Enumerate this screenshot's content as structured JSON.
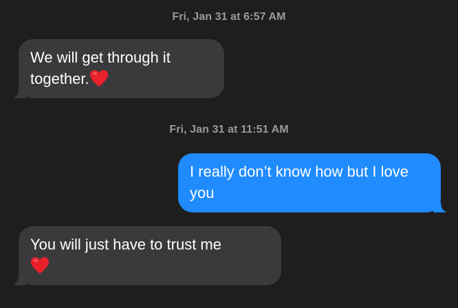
{
  "thread": {
    "timestamps": [
      "Fri, Jan 31 at 6:57 AM",
      "Fri, Jan 31 at 11:51 AM"
    ],
    "messages": [
      {
        "direction": "incoming",
        "text": "We will get through it together.",
        "emoji": "heart-emoji"
      },
      {
        "direction": "outgoing",
        "text": "I really don’t know how but I love you"
      },
      {
        "direction": "incoming",
        "text": "You will just have to trust me",
        "emoji": "heart-emoji"
      }
    ]
  },
  "colors": {
    "background": "#1e1e1e",
    "incoming_bubble": "#3a3a3c",
    "outgoing_bubble": "#1f8bfd",
    "timestamp_text": "#9a9a9e",
    "heart": "#e8212b"
  }
}
